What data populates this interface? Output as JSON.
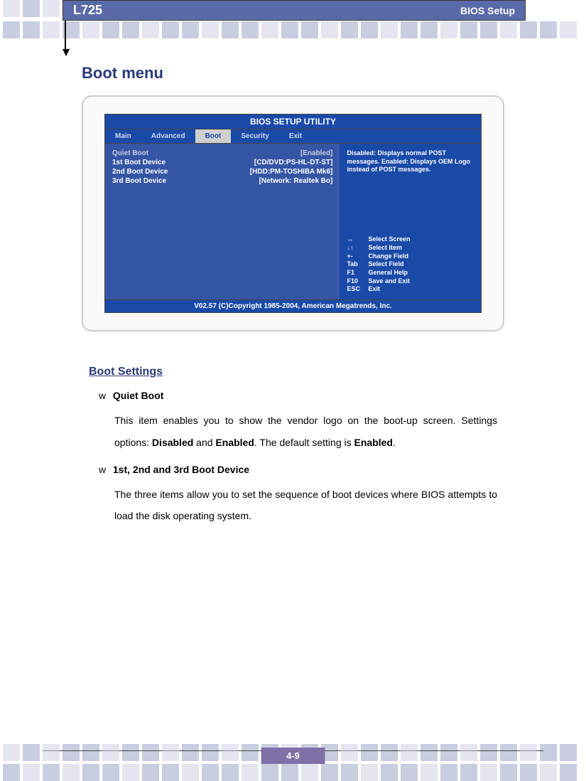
{
  "header": {
    "model": "L725",
    "section": "BIOS Setup"
  },
  "page_title": "Boot menu",
  "bios": {
    "title": "BIOS SETUP UTILITY",
    "tabs": [
      "Main",
      "Advanced",
      "Boot",
      "Security",
      "Exit"
    ],
    "active_tab": "Boot",
    "settings": [
      {
        "label": "Quiet Boot",
        "value": "[Enabled]",
        "selected": true
      },
      {
        "label": "1st Boot Device",
        "value": "[CD/DVD:PS-HL-DT-ST]"
      },
      {
        "label": "2nd Boot Device",
        "value": "[HDD:PM-TOSHIBA Mk6]"
      },
      {
        "label": "3rd Boot Device",
        "value": "[Network: Realtek Bo]"
      }
    ],
    "help_text": "Disabled: Displays normal POST messages. Enabled: Displays OEM Logo instead of POST messages.",
    "keys": [
      {
        "k": "↔",
        "v": "Select Screen"
      },
      {
        "k": "↓↑",
        "v": "Select Item"
      },
      {
        "k": "+-",
        "v": "Change Field"
      },
      {
        "k": "Tab",
        "v": "Select Field"
      },
      {
        "k": "F1",
        "v": "General Help"
      },
      {
        "k": "F10",
        "v": "Save and Exit"
      },
      {
        "k": "ESC",
        "v": "Exit"
      }
    ],
    "footer": "V02.57 (C)Copyright 1985-2004, American Megatrends, Inc."
  },
  "boot_settings": {
    "heading": "Boot Settings",
    "items": [
      {
        "bullet": "w",
        "title": "Quiet Boot",
        "desc_pre": "This item enables you to show the vendor logo on the boot-up screen. Settings options: ",
        "opt1": "Disabled",
        "mid1": " and ",
        "opt2": "Enabled",
        "mid2": ". The default setting is ",
        "opt3": "Enabled",
        "tail": "."
      },
      {
        "bullet": "w",
        "title": "1st, 2nd and 3rd Boot Device",
        "desc": "The three items allow you to set the sequence of boot devices where BIOS attempts to load the disk operating system."
      }
    ]
  },
  "page_number": "4-9"
}
